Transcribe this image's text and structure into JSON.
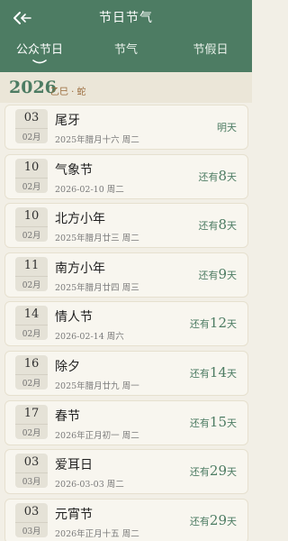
{
  "header": {
    "title": "节日节气",
    "back_icon": "back-arrow-icon",
    "tabs": [
      {
        "label": "公众节日",
        "active": true
      },
      {
        "label": "节气",
        "active": false
      },
      {
        "label": "节假日",
        "active": false
      }
    ]
  },
  "year": {
    "number": "2026",
    "ganzhi": "乙巳 · 蛇"
  },
  "colors": {
    "accent": "#4d7c63",
    "background": "#f2efe6",
    "year_sub": "#9a6b3c"
  },
  "items": [
    {
      "day": "03",
      "month": "02月",
      "name": "尾牙",
      "sub": "2025年腊月十六  周二",
      "prefix": "",
      "num": "",
      "suffix": "明天"
    },
    {
      "day": "10",
      "month": "02月",
      "name": "气象节",
      "sub": "2026-02-10  周二",
      "prefix": "还有",
      "num": "8",
      "suffix": "天"
    },
    {
      "day": "10",
      "month": "02月",
      "name": "北方小年",
      "sub": "2025年腊月廿三  周二",
      "prefix": "还有",
      "num": "8",
      "suffix": "天"
    },
    {
      "day": "11",
      "month": "02月",
      "name": "南方小年",
      "sub": "2025年腊月廿四  周三",
      "prefix": "还有",
      "num": "9",
      "suffix": "天"
    },
    {
      "day": "14",
      "month": "02月",
      "name": "情人节",
      "sub": "2026-02-14  周六",
      "prefix": "还有",
      "num": "12",
      "suffix": "天"
    },
    {
      "day": "16",
      "month": "02月",
      "name": "除夕",
      "sub": "2025年腊月廿九  周一",
      "prefix": "还有",
      "num": "14",
      "suffix": "天"
    },
    {
      "day": "17",
      "month": "02月",
      "name": "春节",
      "sub": "2026年正月初一  周二",
      "prefix": "还有",
      "num": "15",
      "suffix": "天"
    },
    {
      "day": "03",
      "month": "03月",
      "name": "爱耳日",
      "sub": "2026-03-03  周二",
      "prefix": "还有",
      "num": "29",
      "suffix": "天"
    },
    {
      "day": "03",
      "month": "03月",
      "name": "元宵节",
      "sub": "2026年正月十五  周二",
      "prefix": "还有",
      "num": "29",
      "suffix": "天"
    }
  ]
}
